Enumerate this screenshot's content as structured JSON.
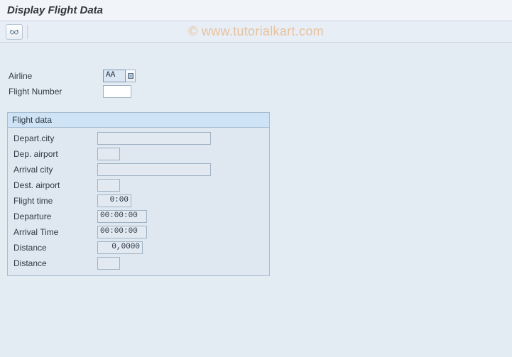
{
  "header": {
    "title": "Display Flight Data"
  },
  "watermark": "© www.tutorialkart.com",
  "inputs": {
    "airline_label": "Airline",
    "airline_value": "AA",
    "flight_no_label": "Flight Number",
    "flight_no_value": ""
  },
  "group": {
    "title": "Flight data",
    "fields": {
      "depart_city_label": "Depart.city",
      "depart_city_value": "",
      "dep_airport_label": "Dep. airport",
      "dep_airport_value": "",
      "arrival_city_label": "Arrival city",
      "arrival_city_value": "",
      "dest_airport_label": "Dest. airport",
      "dest_airport_value": "",
      "flight_time_label": "Flight time",
      "flight_time_value": "0:00",
      "departure_label": "Departure",
      "departure_value": "00:00:00",
      "arrival_time_label": "Arrival Time",
      "arrival_time_value": "00:00:00",
      "distance_label": "Distance",
      "distance_value": "0,0000",
      "distance_unit_label": "Distance",
      "distance_unit_value": ""
    }
  }
}
